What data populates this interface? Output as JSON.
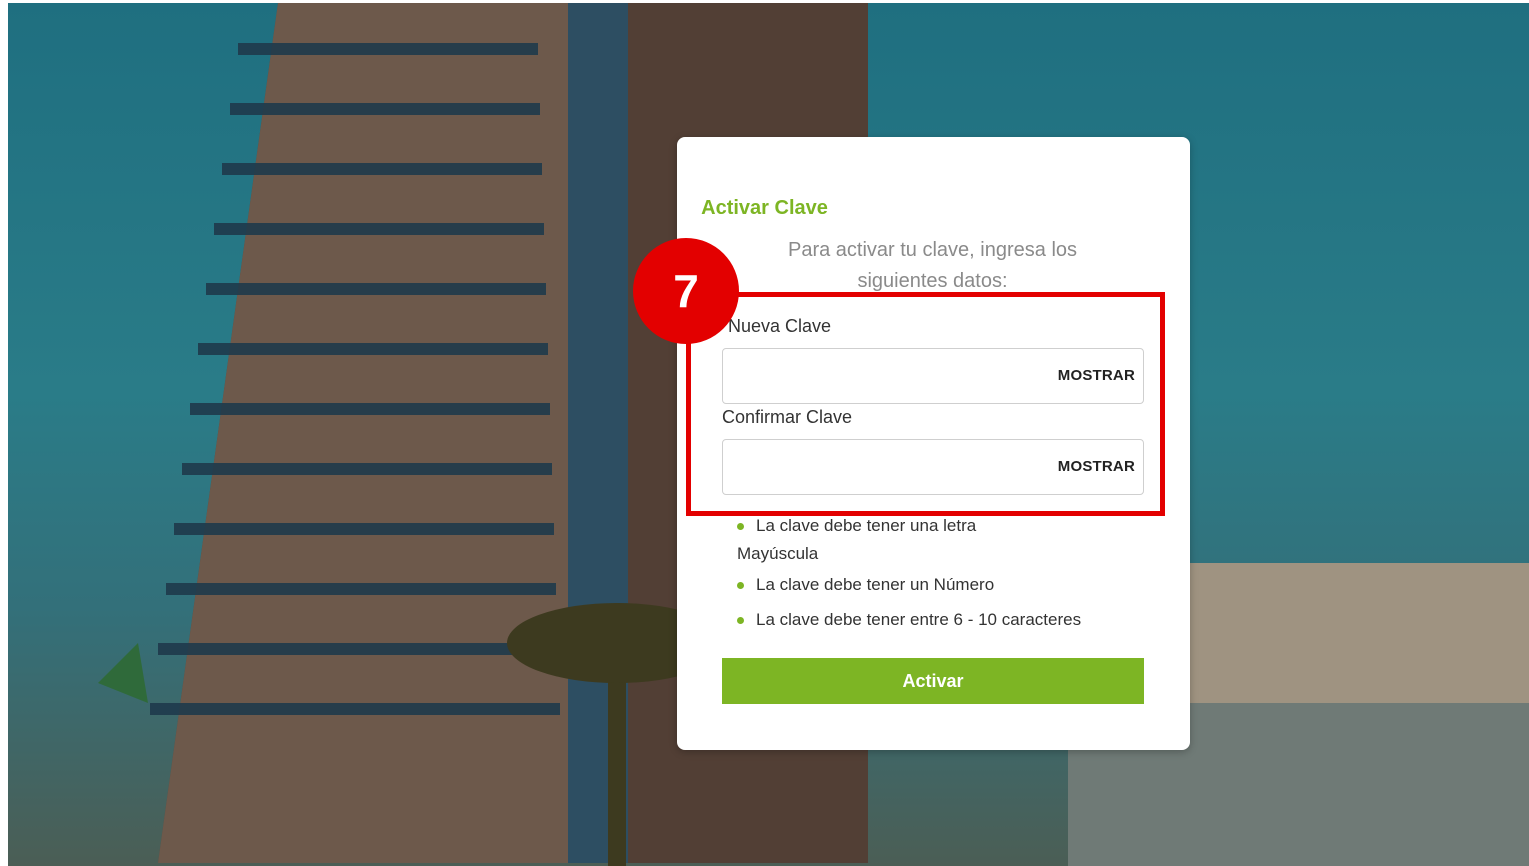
{
  "form": {
    "title": "Activar Clave",
    "subtitle": "Para activar tu clave, ingresa los siguientes datos:",
    "new_password_label": "Nueva Clave",
    "confirm_password_label": "Confirmar Clave",
    "show_label": "MOSTRAR",
    "rules": [
      "La clave debe tener una letra Mayúscula",
      "La clave debe tener un Número",
      "La clave debe tener entre 6 - 10 caracteres"
    ],
    "submit_label": "Activar"
  },
  "annotation": {
    "step_number": "7",
    "color": "#e30000"
  },
  "colors": {
    "accent": "#7db524"
  }
}
